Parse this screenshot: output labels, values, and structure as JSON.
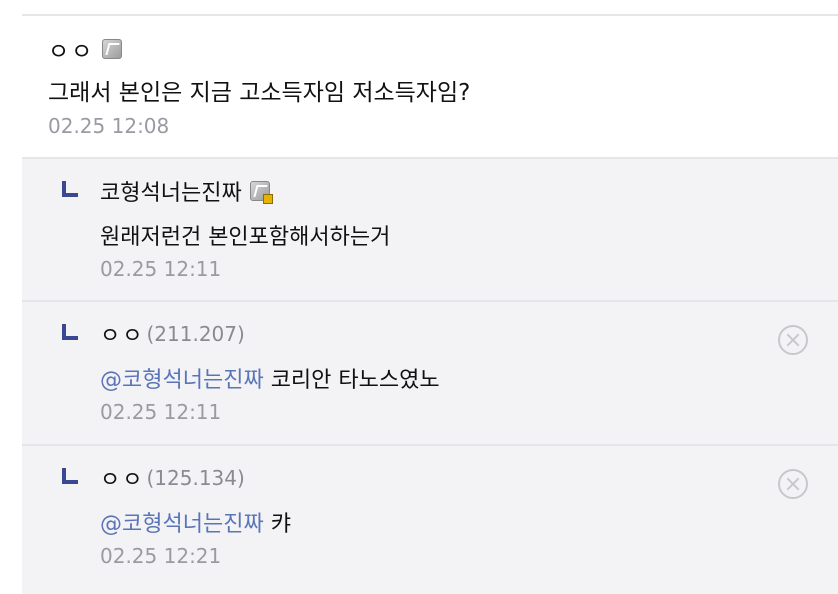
{
  "comment": {
    "author": "ㅇㅇ",
    "text": "그래서 본인은 지금 고소득자임 저소득자임?",
    "date": "02.25 12:08"
  },
  "replies": [
    {
      "author": "코형석너는진짜",
      "ip": "",
      "mention": "",
      "text": "원래저런건 본인포함해서하는거",
      "date": "02.25 12:11"
    },
    {
      "author": "ㅇㅇ",
      "ip": "(211.207)",
      "mention": "@코형석너는진짜",
      "text": "코리안 타노스였노",
      "date": "02.25 12:11"
    },
    {
      "author": "ㅇㅇ",
      "ip": "(125.134)",
      "mention": "@코형석너는진짜",
      "text": "캬",
      "date": "02.25 12:21"
    }
  ],
  "colors": {
    "mention": "#5a74b8",
    "reply_arrow": "#3b4890",
    "reply_bg": "#f3f3f6",
    "date": "#9a9aa2"
  },
  "icons": {
    "nick_icon": "fixed-nick-icon",
    "nick_icon_gold": "fixed-nick-gold-icon",
    "delete": "delete-circle-x-icon",
    "reply_arrow": "reply-arrow-icon"
  }
}
